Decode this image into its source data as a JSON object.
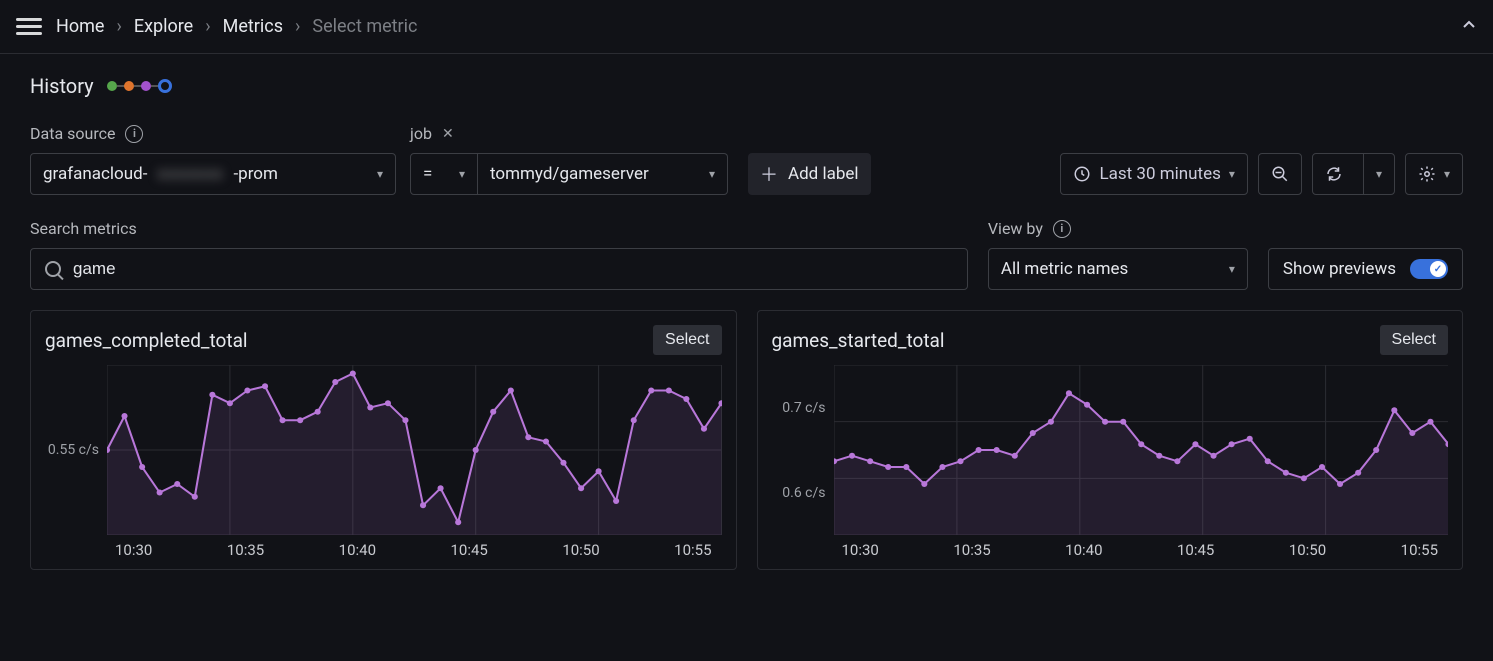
{
  "breadcrumbs": {
    "home": "Home",
    "explore": "Explore",
    "metrics": "Metrics",
    "select": "Select metric"
  },
  "history_label": "History",
  "datasource": {
    "label": "Data source",
    "value_prefix": "grafanacloud-",
    "value_hidden": "xxxxxxx",
    "value_suffix": "-prom"
  },
  "job": {
    "label": "job",
    "op": "=",
    "value": "tommyd/gameserver"
  },
  "add_label": "Add label",
  "time_range": "Last 30 minutes",
  "search": {
    "label": "Search metrics",
    "value": "game"
  },
  "view_by": {
    "label": "View by",
    "value": "All metric names"
  },
  "show_previews": "Show previews",
  "panels": [
    {
      "title": "games_completed_total",
      "select": "Select"
    },
    {
      "title": "games_started_total",
      "select": "Select"
    }
  ],
  "chart_data": [
    {
      "type": "line",
      "title": "games_completed_total",
      "xlabel": "",
      "ylabel": "",
      "x_ticks": [
        "10:30",
        "10:35",
        "10:40",
        "10:45",
        "10:50",
        "10:55"
      ],
      "y_ticks": [
        "0.55 c/s"
      ],
      "ylim": [
        0.35,
        0.75
      ],
      "series": [
        {
          "name": "games_completed_total",
          "values": [
            0.55,
            0.63,
            0.51,
            0.45,
            0.47,
            0.44,
            0.68,
            0.66,
            0.69,
            0.7,
            0.62,
            0.62,
            0.64,
            0.71,
            0.73,
            0.65,
            0.66,
            0.62,
            0.42,
            0.46,
            0.38,
            0.55,
            0.64,
            0.69,
            0.58,
            0.57,
            0.52,
            0.46,
            0.5,
            0.43,
            0.62,
            0.69,
            0.69,
            0.67,
            0.6,
            0.66
          ]
        }
      ]
    },
    {
      "type": "line",
      "title": "games_started_total",
      "xlabel": "",
      "ylabel": "",
      "x_ticks": [
        "10:30",
        "10:35",
        "10:40",
        "10:45",
        "10:50",
        "10:55"
      ],
      "y_ticks": [
        "0.7 c/s",
        "0.6 c/s"
      ],
      "ylim": [
        0.5,
        0.8
      ],
      "series": [
        {
          "name": "games_started_total",
          "values": [
            0.63,
            0.64,
            0.63,
            0.62,
            0.62,
            0.59,
            0.62,
            0.63,
            0.65,
            0.65,
            0.64,
            0.68,
            0.7,
            0.75,
            0.73,
            0.7,
            0.7,
            0.66,
            0.64,
            0.63,
            0.66,
            0.64,
            0.66,
            0.67,
            0.63,
            0.61,
            0.6,
            0.62,
            0.59,
            0.61,
            0.65,
            0.72,
            0.68,
            0.7,
            0.66
          ]
        }
      ]
    }
  ]
}
